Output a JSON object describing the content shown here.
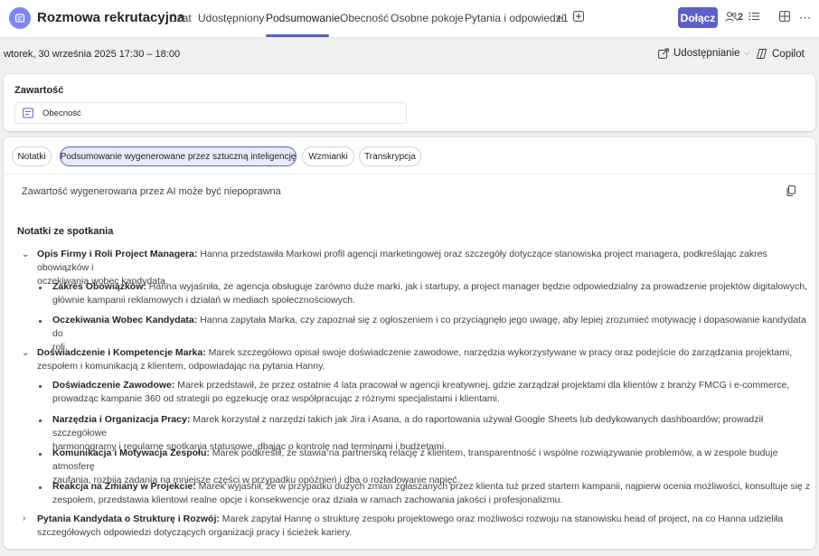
{
  "header": {
    "title": "Rozmowa rekrutacyjna",
    "tabs": [
      {
        "label": "Czat"
      },
      {
        "label": "Udostępniony"
      },
      {
        "label": "Podsumowanie"
      },
      {
        "label": "Obecność"
      },
      {
        "label": "Osobne pokoje"
      },
      {
        "label": "Pytania i odpowiedzi"
      },
      {
        "label": "+1"
      }
    ],
    "join_label": "Dołącz",
    "participants_count": "2"
  },
  "meeting": {
    "datetime": "wtorek, 30 września 2025 17:30 – 18:00",
    "share_label": "Udostępnianie",
    "copilot_label": "Copilot"
  },
  "content": {
    "title": "Zawartość",
    "attendance_label": "Obecność"
  },
  "summary": {
    "tabs": [
      {
        "label": "Notatki"
      },
      {
        "label": "Podsumowanie wygenerowane przez sztuczną inteligencję"
      },
      {
        "label": "Wzmianki"
      },
      {
        "label": "Transkrypcja"
      }
    ],
    "ai_notice": "Zawartość wygenerowana przez AI może być niepoprawna",
    "notes_title": "Notatki ze spotkania",
    "sections": [
      {
        "title": "Opis Firmy i Roli Project Managera:",
        "text_lines": [
          "Hanna przedstawiła Markowi profil agencji marketingowej oraz szczegóły dotyczące stanowiska project managera, podkreślając zakres obowiązków i",
          "oczekiwania wobec kandydata."
        ],
        "bullets": [
          {
            "title": "Zakres Obowiązków:",
            "lines": [
              "Hanna wyjaśniła, że agencja obsługuje zarówno duże marki, jak i startupy, a project manager będzie odpowiedzialny za prowadzenie projektów digitalowych,",
              "głównie kampanii reklamowych i działań w mediach społecznościowych."
            ]
          },
          {
            "title": "Oczekiwania Wobec Kandydata:",
            "lines": [
              "Hanna zapytała Marka, czy zapoznał się z ogłoszeniem i co przyciągnęło jego uwagę, aby lepiej zrozumieć motywację i dopasowanie kandydata do",
              "roli."
            ]
          }
        ]
      },
      {
        "title": "Doświadczenie i Kompetencje Marka:",
        "text_lines": [
          "Marek szczegółowo opisał swoje doświadczenie zawodowe, narzędzia wykorzystywane w pracy oraz podejście do zarządzania projektami,",
          "zespołem i komunikacją z klientem, odpowiadając na pytania Hanny."
        ],
        "bullets": [
          {
            "title": "Doświadczenie Zawodowe:",
            "lines": [
              "Marek przedstawił, że przez ostatnie 4 lata pracował w agencji kreatywnej, gdzie zarządzał projektami dla klientów z branży FMCG i e-commerce,",
              "prowadząc kampanie 360 od strategii po egzekucję oraz współpracując z różnymi specjalistami i klientami."
            ]
          },
          {
            "title": "Narzędzia i Organizacja Pracy:",
            "lines": [
              "Marek korzystał z narzędzi takich jak Jira i Asana, a do raportowania używał Google Sheets lub dedykowanych dashboardów; prowadził szczegółowe",
              "harmonogramy i regularne spotkania statusowe, dbając o kontrolę nad terminami i budżetami."
            ]
          },
          {
            "title": "Komunikacja i Motywacja Zespołu:",
            "lines": [
              "Marek podkreślił, że stawia na partnerską relację z klientem, transparentność i wspólne rozwiązywanie problemów, a w zespole buduje atmosferę",
              "zaufania, rozbija zadania na mniejsze części w przypadku opóźnień i dba o rozładowanie napięć."
            ]
          },
          {
            "title": "Reakcja na Zmiany w Projekcie:",
            "lines": [
              "Marek wyjaśnił, że w przypadku dużych zmian zgłaszanych przez klienta tuż przed startem kampanii, najpierw ocenia możliwości, konsultuje się z",
              "zespołem, przedstawia klientowi realne opcje i konsekwencje oraz działa w ramach zachowania jakości i profesjonalizmu."
            ]
          }
        ]
      },
      {
        "title": "Pytania Kandydata o Strukturę i Rozwój:",
        "text_lines": [
          "Marek zapytał Hannę o strukturę zespołu projektowego oraz możliwości rozwoju na stanowisku head of project, na co Hanna udzieliła",
          "szczegółowych odpowiedzi dotyczących organizacji pracy i ścieżek kariery."
        ],
        "bullets": []
      }
    ]
  }
}
